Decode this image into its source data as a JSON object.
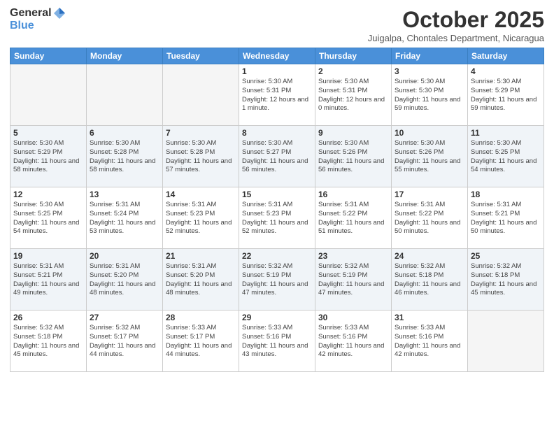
{
  "header": {
    "logo_general": "General",
    "logo_blue": "Blue",
    "month_title": "October 2025",
    "location": "Juigalpa, Chontales Department, Nicaragua"
  },
  "weekdays": [
    "Sunday",
    "Monday",
    "Tuesday",
    "Wednesday",
    "Thursday",
    "Friday",
    "Saturday"
  ],
  "weeks": [
    [
      {
        "day": "",
        "info": ""
      },
      {
        "day": "",
        "info": ""
      },
      {
        "day": "",
        "info": ""
      },
      {
        "day": "1",
        "info": "Sunrise: 5:30 AM\nSunset: 5:31 PM\nDaylight: 12 hours\nand 1 minute."
      },
      {
        "day": "2",
        "info": "Sunrise: 5:30 AM\nSunset: 5:31 PM\nDaylight: 12 hours\nand 0 minutes."
      },
      {
        "day": "3",
        "info": "Sunrise: 5:30 AM\nSunset: 5:30 PM\nDaylight: 11 hours\nand 59 minutes."
      },
      {
        "day": "4",
        "info": "Sunrise: 5:30 AM\nSunset: 5:29 PM\nDaylight: 11 hours\nand 59 minutes."
      }
    ],
    [
      {
        "day": "5",
        "info": "Sunrise: 5:30 AM\nSunset: 5:29 PM\nDaylight: 11 hours\nand 58 minutes."
      },
      {
        "day": "6",
        "info": "Sunrise: 5:30 AM\nSunset: 5:28 PM\nDaylight: 11 hours\nand 58 minutes."
      },
      {
        "day": "7",
        "info": "Sunrise: 5:30 AM\nSunset: 5:28 PM\nDaylight: 11 hours\nand 57 minutes."
      },
      {
        "day": "8",
        "info": "Sunrise: 5:30 AM\nSunset: 5:27 PM\nDaylight: 11 hours\nand 56 minutes."
      },
      {
        "day": "9",
        "info": "Sunrise: 5:30 AM\nSunset: 5:26 PM\nDaylight: 11 hours\nand 56 minutes."
      },
      {
        "day": "10",
        "info": "Sunrise: 5:30 AM\nSunset: 5:26 PM\nDaylight: 11 hours\nand 55 minutes."
      },
      {
        "day": "11",
        "info": "Sunrise: 5:30 AM\nSunset: 5:25 PM\nDaylight: 11 hours\nand 54 minutes."
      }
    ],
    [
      {
        "day": "12",
        "info": "Sunrise: 5:30 AM\nSunset: 5:25 PM\nDaylight: 11 hours\nand 54 minutes."
      },
      {
        "day": "13",
        "info": "Sunrise: 5:31 AM\nSunset: 5:24 PM\nDaylight: 11 hours\nand 53 minutes."
      },
      {
        "day": "14",
        "info": "Sunrise: 5:31 AM\nSunset: 5:23 PM\nDaylight: 11 hours\nand 52 minutes."
      },
      {
        "day": "15",
        "info": "Sunrise: 5:31 AM\nSunset: 5:23 PM\nDaylight: 11 hours\nand 52 minutes."
      },
      {
        "day": "16",
        "info": "Sunrise: 5:31 AM\nSunset: 5:22 PM\nDaylight: 11 hours\nand 51 minutes."
      },
      {
        "day": "17",
        "info": "Sunrise: 5:31 AM\nSunset: 5:22 PM\nDaylight: 11 hours\nand 50 minutes."
      },
      {
        "day": "18",
        "info": "Sunrise: 5:31 AM\nSunset: 5:21 PM\nDaylight: 11 hours\nand 50 minutes."
      }
    ],
    [
      {
        "day": "19",
        "info": "Sunrise: 5:31 AM\nSunset: 5:21 PM\nDaylight: 11 hours\nand 49 minutes."
      },
      {
        "day": "20",
        "info": "Sunrise: 5:31 AM\nSunset: 5:20 PM\nDaylight: 11 hours\nand 48 minutes."
      },
      {
        "day": "21",
        "info": "Sunrise: 5:31 AM\nSunset: 5:20 PM\nDaylight: 11 hours\nand 48 minutes."
      },
      {
        "day": "22",
        "info": "Sunrise: 5:32 AM\nSunset: 5:19 PM\nDaylight: 11 hours\nand 47 minutes."
      },
      {
        "day": "23",
        "info": "Sunrise: 5:32 AM\nSunset: 5:19 PM\nDaylight: 11 hours\nand 47 minutes."
      },
      {
        "day": "24",
        "info": "Sunrise: 5:32 AM\nSunset: 5:18 PM\nDaylight: 11 hours\nand 46 minutes."
      },
      {
        "day": "25",
        "info": "Sunrise: 5:32 AM\nSunset: 5:18 PM\nDaylight: 11 hours\nand 45 minutes."
      }
    ],
    [
      {
        "day": "26",
        "info": "Sunrise: 5:32 AM\nSunset: 5:18 PM\nDaylight: 11 hours\nand 45 minutes."
      },
      {
        "day": "27",
        "info": "Sunrise: 5:32 AM\nSunset: 5:17 PM\nDaylight: 11 hours\nand 44 minutes."
      },
      {
        "day": "28",
        "info": "Sunrise: 5:33 AM\nSunset: 5:17 PM\nDaylight: 11 hours\nand 44 minutes."
      },
      {
        "day": "29",
        "info": "Sunrise: 5:33 AM\nSunset: 5:16 PM\nDaylight: 11 hours\nand 43 minutes."
      },
      {
        "day": "30",
        "info": "Sunrise: 5:33 AM\nSunset: 5:16 PM\nDaylight: 11 hours\nand 42 minutes."
      },
      {
        "day": "31",
        "info": "Sunrise: 5:33 AM\nSunset: 5:16 PM\nDaylight: 11 hours\nand 42 minutes."
      },
      {
        "day": "",
        "info": ""
      }
    ]
  ]
}
